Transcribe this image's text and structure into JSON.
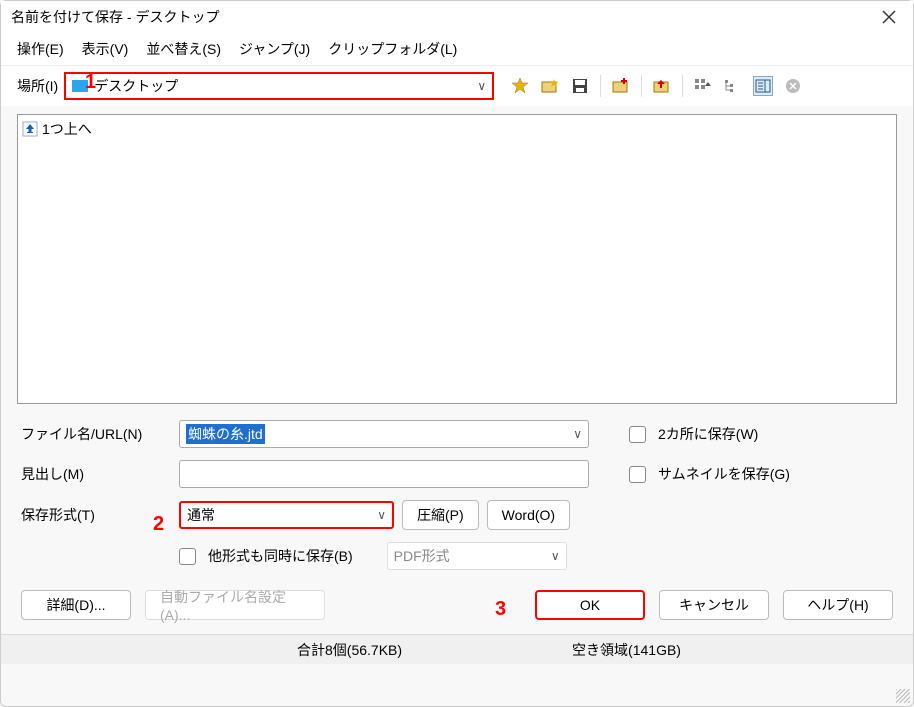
{
  "title": "名前を付けて保存 -                                           デスクトップ",
  "menubar": {
    "edit": "操作(E)",
    "view": "表示(V)",
    "sort": "並べ替え(S)",
    "jump": "ジャンプ(J)",
    "clip": "クリップフォルダ(L)"
  },
  "annotations": {
    "one": "1",
    "two": "2",
    "three": "3"
  },
  "location": {
    "label": "場所(I)",
    "value": "デスクトップ"
  },
  "filelist": {
    "up": "1つ上へ"
  },
  "form": {
    "filename_label": "ファイル名/URL(N)",
    "filename_value": "蜘蛛の糸.jtd",
    "heading_label": "見出し(M)",
    "heading_value": "",
    "format_label": "保存形式(T)",
    "format_value": "通常",
    "compress_btn": "圧縮(P)",
    "word_btn": "Word(O)",
    "also_save_other": "他形式も同時に保存(B)",
    "pdf_format": "PDF形式",
    "save_two_places": "2カ所に保存(W)",
    "save_thumbnail": "サムネイルを保存(G)"
  },
  "buttons": {
    "details": "詳細(D)...",
    "auto_filename": "自動ファイル名設定(A)...",
    "ok": "OK",
    "cancel": "キャンセル",
    "help": "ヘルプ(H)"
  },
  "status": {
    "total": "合計8個(56.7KB)",
    "free": "空き領域(141GB)"
  }
}
